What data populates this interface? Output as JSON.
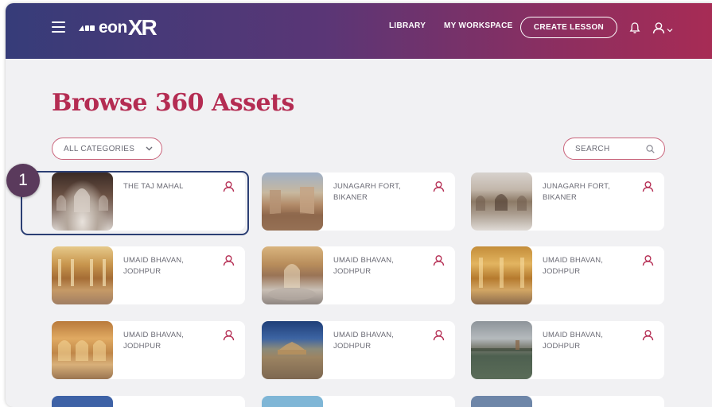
{
  "header": {
    "logo_eon": "eon",
    "logo_xr": "XR",
    "nav": [
      {
        "label": "LIBRARY"
      },
      {
        "label": "MY WORKSPACE"
      }
    ],
    "create_label": "CREATE LESSON"
  },
  "page": {
    "title": "Browse 360 Assets"
  },
  "filters": {
    "category_label": "ALL CATEGORIES",
    "search_placeholder": "SEARCH"
  },
  "cards": [
    {
      "name": "THE TAJ MAHAL"
    },
    {
      "name": "JUNAGARH FORT, BIKANER"
    },
    {
      "name": "JUNAGARH FORT, BIKANER"
    },
    {
      "name": "UMAID BHAVAN, JODHPUR"
    },
    {
      "name": "UMAID BHAVAN, JODHPUR"
    },
    {
      "name": "UMAID BHAVAN, JODHPUR"
    },
    {
      "name": "UMAID BHAVAN, JODHPUR"
    },
    {
      "name": "UMAID BHAVAN, JODHPUR"
    },
    {
      "name": "UMAID BHAVAN, JODHPUR"
    }
  ],
  "step_badge": "1",
  "colors": {
    "accent": "#b42c52",
    "header_start": "#363c79",
    "header_end": "#a72c55",
    "highlight": "#2c3f74"
  },
  "icons": [
    "menu-icon",
    "eon-logo-mark-icon",
    "bell-icon",
    "user-icon",
    "chevron-down-icon",
    "search-icon"
  ]
}
